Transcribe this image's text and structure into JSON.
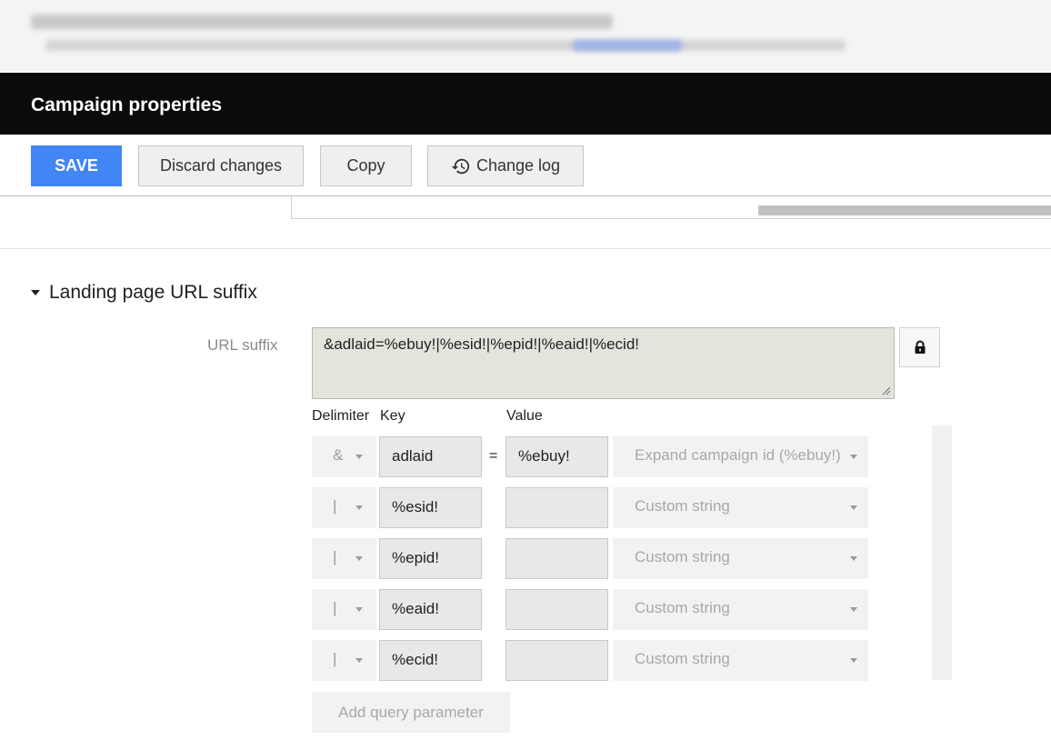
{
  "header": {
    "title": "Campaign properties"
  },
  "toolbar": {
    "save_label": "SAVE",
    "discard_label": "Discard changes",
    "copy_label": "Copy",
    "changelog_label": "Change log"
  },
  "section": {
    "title": "Landing page URL suffix",
    "url_label": "URL suffix",
    "url_value": "&adlaid=%ebuy!|%esid!|%epid!|%eaid!|%ecid!"
  },
  "columns": {
    "delimiter": "Delimiter",
    "key": "Key",
    "value": "Value"
  },
  "params": [
    {
      "delimiter": "&",
      "key": "adlaid",
      "eq": "=",
      "value": "%ebuy!",
      "type": "Expand campaign id (%ebuy!)"
    },
    {
      "delimiter": "|",
      "key": "%esid!",
      "eq": "",
      "value": "",
      "type": "Custom string"
    },
    {
      "delimiter": "|",
      "key": "%epid!",
      "eq": "",
      "value": "",
      "type": "Custom string"
    },
    {
      "delimiter": "|",
      "key": "%eaid!",
      "eq": "",
      "value": "",
      "type": "Custom string"
    },
    {
      "delimiter": "|",
      "key": "%ecid!",
      "eq": "",
      "value": "",
      "type": "Custom string"
    }
  ],
  "add_param_label": "Add query parameter",
  "colors": {
    "save_blue": "#4285f4",
    "header_bg": "#0b0b0b",
    "textarea_bg": "#e4e4dc"
  },
  "icons": [
    "history-icon",
    "lock-icon",
    "caret-down-icon",
    "dropdown-arrow-icon",
    "resize-grip-icon"
  ]
}
